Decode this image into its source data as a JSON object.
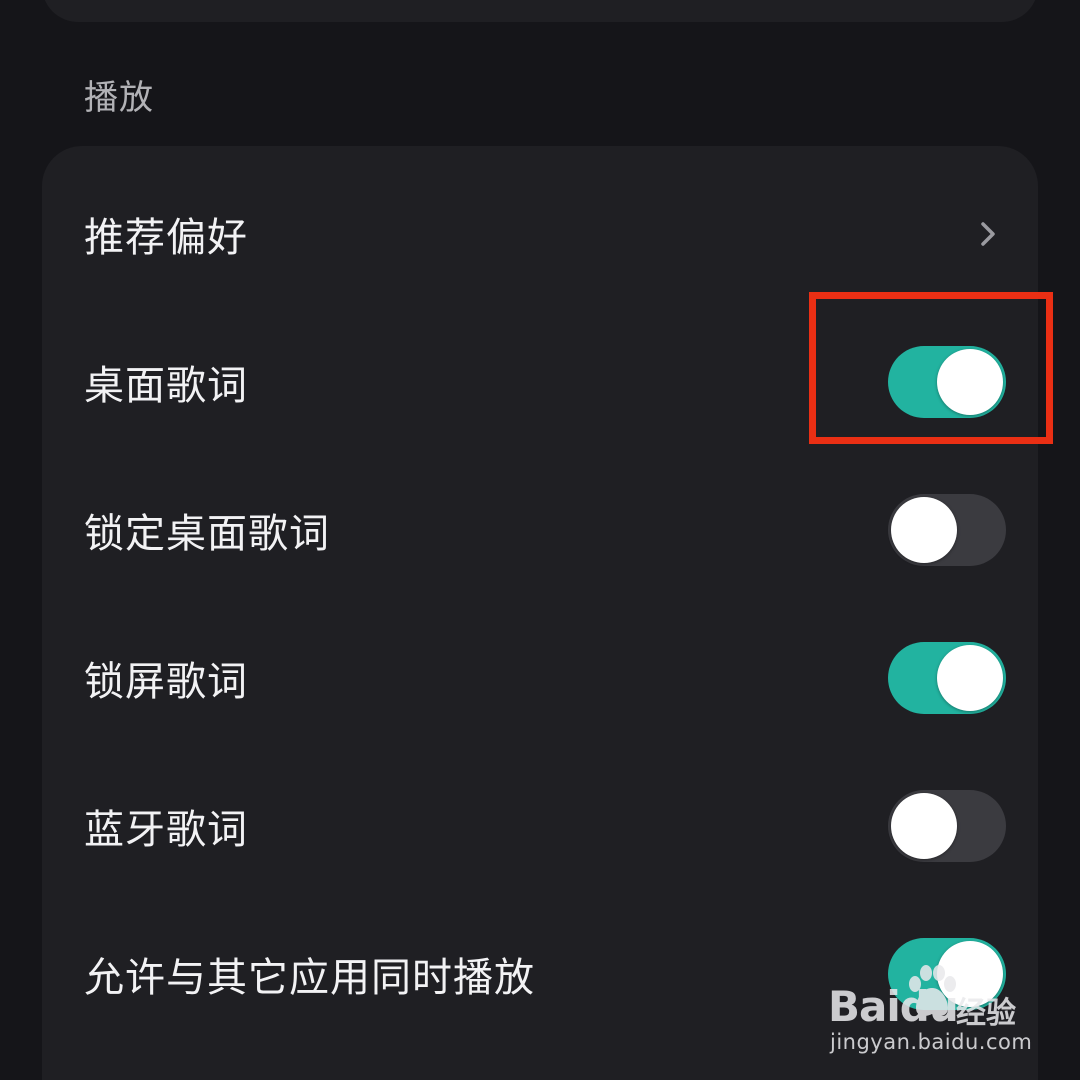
{
  "section": {
    "title": "播放"
  },
  "settings": {
    "items": [
      {
        "label": "推荐偏好",
        "control": "chevron"
      },
      {
        "label": "桌面歌词",
        "control": "toggle",
        "state": "on"
      },
      {
        "label": "锁定桌面歌词",
        "control": "toggle",
        "state": "off"
      },
      {
        "label": "锁屏歌词",
        "control": "toggle",
        "state": "on"
      },
      {
        "label": "蓝牙歌词",
        "control": "toggle",
        "state": "off"
      },
      {
        "label": "允许与其它应用同时播放",
        "control": "toggle",
        "state": "on"
      }
    ]
  },
  "watermark": {
    "brand": "Baidu",
    "product": "经验",
    "url": "jingyan.baidu.com"
  },
  "colors": {
    "background": "#151519",
    "card": "#1f1f23",
    "toggle_on": "#22b3a0",
    "toggle_off": "#3b3b40",
    "highlight": "#ea2f14"
  },
  "icons": {
    "chevron": "chevron-right-icon",
    "paw": "baidu-paw-icon"
  }
}
